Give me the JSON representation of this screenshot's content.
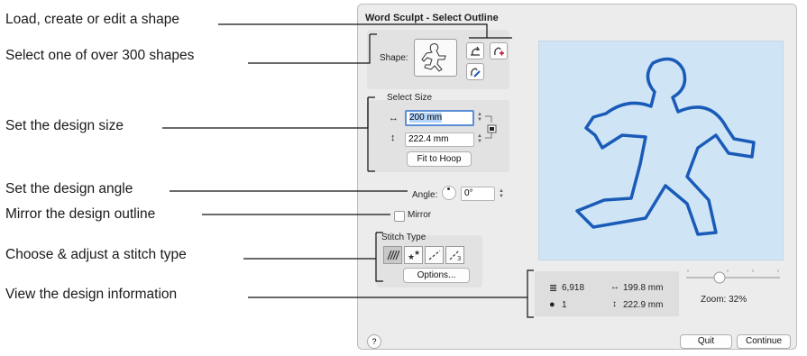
{
  "annotations": [
    "Load, create or edit a shape",
    "Select one of over 300 shapes",
    "Set the design size",
    "Set the design angle",
    "Mirror the design outline",
    "Choose & adjust a stitch type",
    "View the design information"
  ],
  "dialog": {
    "title": "Word Sculpt - Select Outline",
    "shape_label": "Shape:",
    "select_size_label": "Select Size",
    "width_value": "200 mm",
    "height_value": "222.4 mm",
    "fit_to_hoop": "Fit to Hoop",
    "angle_label": "Angle:",
    "angle_value": "0°",
    "mirror_label": "Mirror",
    "stitch_type_label": "Stitch Type",
    "options_button": "Options...",
    "info": {
      "stitch_count": "6,918",
      "color_count": "1",
      "width": "199.8 mm",
      "height": "222.9 mm"
    },
    "zoom_label": "Zoom: 32%",
    "zoom_value_percent": 32,
    "help_button": "?",
    "quit_button": "Quit",
    "continue_button": "Continue"
  },
  "colors": {
    "preview_bg": "#cfe5f6",
    "outline": "#1a5bb8"
  }
}
